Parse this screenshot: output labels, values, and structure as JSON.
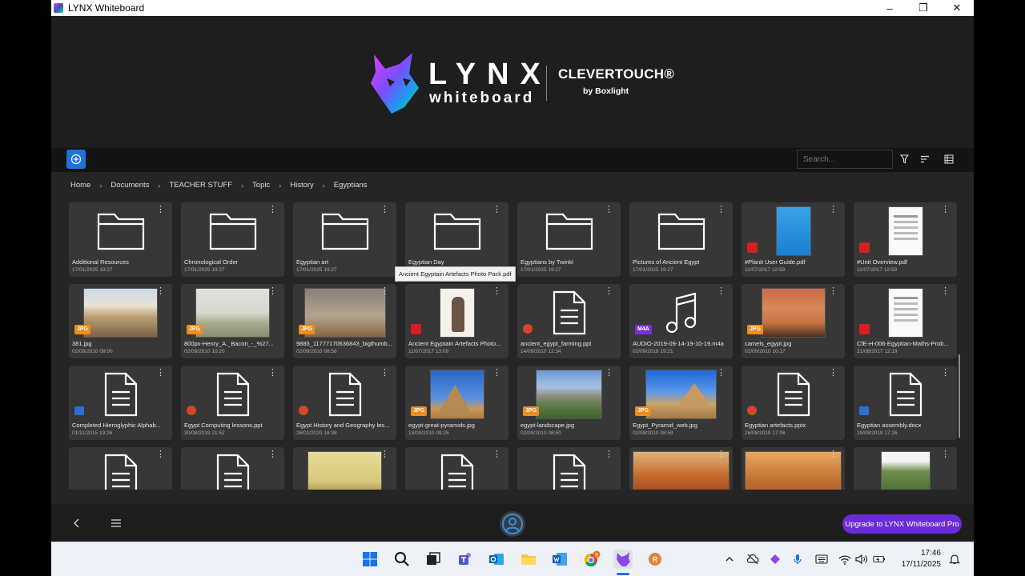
{
  "window": {
    "title": "LYNX Whiteboard",
    "minimize": "–",
    "maximize": "❐",
    "close": "✕"
  },
  "brand": {
    "lynx": "LYNX",
    "whiteboard": "whiteboard",
    "clevertouch": "CLEVERTOUCH®",
    "by": "by Boxlight"
  },
  "toolbar": {
    "search_placeholder": "Search..."
  },
  "breadcrumb": [
    "Home",
    "Documents",
    "TEACHER STUFF",
    "Topic",
    "History",
    "Egyptians"
  ],
  "tooltip": "Ancient Egyptain Artefacts Photo Pack.pdf",
  "files": [
    {
      "name": "Additional Resources",
      "date": "17/01/2025 19:27",
      "kind": "folder"
    },
    {
      "name": "Chronological Order",
      "date": "17/01/2025 19:27",
      "kind": "folder"
    },
    {
      "name": "Egyptian art",
      "date": "17/01/2025 19:27",
      "kind": "folder"
    },
    {
      "name": "Egyptian Day",
      "date": "17/01/2025 19:27",
      "kind": "folder"
    },
    {
      "name": "Egyptians by Twinkl",
      "date": "17/01/2025 19:27",
      "kind": "folder"
    },
    {
      "name": "Pictures of Ancient Egypt",
      "date": "17/01/2025 19:27",
      "kind": "folder"
    },
    {
      "name": "#Planit User Guide.pdf",
      "date": "11/07/2017 12:59",
      "kind": "pdf",
      "thumb": "blue-doc"
    },
    {
      "name": "#Unit Overview.pdf",
      "date": "11/07/2017 12:59",
      "kind": "pdf",
      "thumb": "white-doc"
    },
    {
      "name": "381.jpg",
      "date": "02/09/2010 09:00",
      "kind": "jpg",
      "badge": "JPG",
      "thumb": "desert"
    },
    {
      "name": "800px-Henry_A._Bacon_-_%27...",
      "date": "02/09/2010 10:20",
      "kind": "jpg",
      "badge": "JPG",
      "thumb": "painting"
    },
    {
      "name": "9885_11777170636843_bigthumb...",
      "date": "02/09/2010 08:58",
      "kind": "jpg",
      "badge": "JPG",
      "thumb": "dust"
    },
    {
      "name": "Ancient Egyptain Artefacts Photo...",
      "date": "11/07/2017 13:09",
      "kind": "pdf",
      "thumb": "cat"
    },
    {
      "name": "ancient_egypt_farming.ppt",
      "date": "14/09/2010 12:34",
      "kind": "ppt"
    },
    {
      "name": "AUDIO-2019-09-14-19-10-19.m4a",
      "date": "02/09/2019 19:21",
      "kind": "m4a",
      "badge": "M4A"
    },
    {
      "name": "camels_egypt.jpg",
      "date": "02/09/2010 10:17",
      "kind": "jpg",
      "badge": "JPG",
      "thumb": "camels"
    },
    {
      "name": "CfE-H-006-Egyptian-Maths-Prob...",
      "date": "21/08/2017 12:19",
      "kind": "pdf",
      "thumb": "white-doc"
    },
    {
      "name": "Completed Hieroglyphic Alphab...",
      "date": "01/11/2015 19:26",
      "kind": "doc"
    },
    {
      "name": "Egypt Computing lessons.ppt",
      "date": "30/08/2019 21:52",
      "kind": "ppt"
    },
    {
      "name": "Egypt History and Geography les...",
      "date": "26/01/2020 18:38",
      "kind": "ppt"
    },
    {
      "name": "egypt-great-pyramids.jpg",
      "date": "13/09/2010 09:25",
      "kind": "jpg",
      "badge": "JPG",
      "thumb": "pyramids"
    },
    {
      "name": "egypt-landscape.jpg",
      "date": "02/09/2010 08:50",
      "kind": "jpg",
      "badge": "JPG",
      "thumb": "landscape"
    },
    {
      "name": "Egypt_Pyramid_web.jpg",
      "date": "02/09/2010 08:59",
      "kind": "jpg",
      "badge": "JPG",
      "thumb": "sphinx"
    },
    {
      "name": "Egyptian artefacts.pptx",
      "date": "26/08/2019 17:06",
      "kind": "ppt"
    },
    {
      "name": "Egyptian assembly.docx",
      "date": "19/09/2019 17:26",
      "kind": "doc"
    },
    {
      "name": "",
      "date": "",
      "kind": "ppt-partial"
    },
    {
      "name": "",
      "date": "",
      "kind": "doc-partial"
    },
    {
      "name": "",
      "date": "",
      "kind": "img-partial",
      "thumb": "oldpaint"
    },
    {
      "name": "",
      "date": "",
      "kind": "doc-partial"
    },
    {
      "name": "",
      "date": "",
      "kind": "ppt-partial"
    },
    {
      "name": "",
      "date": "",
      "kind": "img-partial",
      "thumb": "orange"
    },
    {
      "name": "",
      "date": "",
      "kind": "img-partial",
      "thumb": "orange2"
    },
    {
      "name": "",
      "date": "",
      "kind": "img-partial",
      "thumb": "green"
    }
  ],
  "bottom": {
    "upgrade_label": "Upgrade to LYNX Whiteboard Pro"
  },
  "taskbar": {
    "time": "17:46",
    "date": "17/11/2025",
    "chrome_badge": "6"
  },
  "colors": {
    "accent_blue": "#1f72d8",
    "upgrade_purple": "#6a2bd8",
    "jpg_badge": "#f08c1e",
    "m4a_badge": "#7b2fd6",
    "pdf_red": "#d32020"
  }
}
